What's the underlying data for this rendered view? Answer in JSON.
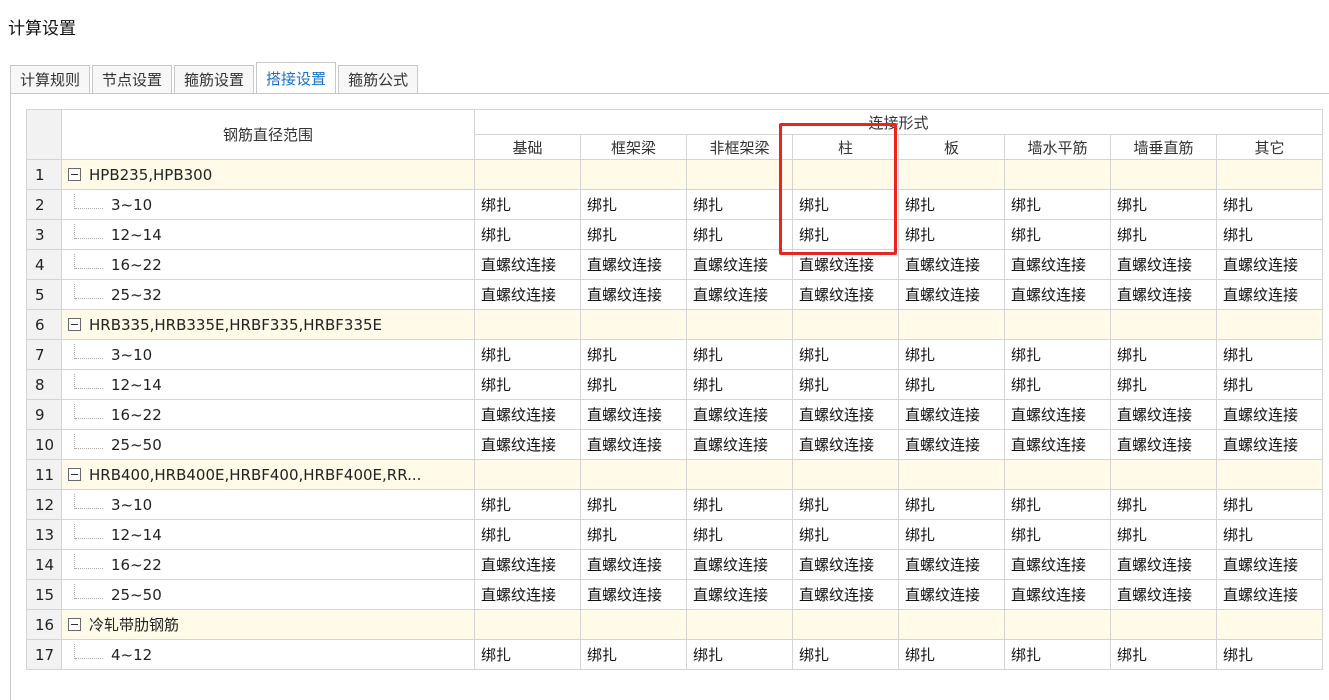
{
  "window": {
    "title": "计算设置"
  },
  "tabs": [
    {
      "label": "计算规则",
      "active": false
    },
    {
      "label": "节点设置",
      "active": false
    },
    {
      "label": "箍筋设置",
      "active": false
    },
    {
      "label": "搭接设置",
      "active": true
    },
    {
      "label": "箍筋公式",
      "active": false
    }
  ],
  "grid": {
    "range_header": "钢筋直径范围",
    "group_header": "连接形式",
    "columns": [
      "基础",
      "框架梁",
      "非框架梁",
      "柱",
      "板",
      "墙水平筋",
      "墙垂直筋",
      "其它"
    ],
    "rows": [
      {
        "num": "1",
        "type": "group",
        "name": "HPB235,HPB300"
      },
      {
        "num": "2",
        "type": "item",
        "name": "3~10",
        "values": [
          "绑扎",
          "绑扎",
          "绑扎",
          "绑扎",
          "绑扎",
          "绑扎",
          "绑扎",
          "绑扎"
        ]
      },
      {
        "num": "3",
        "type": "item",
        "name": "12~14",
        "values": [
          "绑扎",
          "绑扎",
          "绑扎",
          "绑扎",
          "绑扎",
          "绑扎",
          "绑扎",
          "绑扎"
        ]
      },
      {
        "num": "4",
        "type": "item",
        "name": "16~22",
        "values": [
          "直螺纹连接",
          "直螺纹连接",
          "直螺纹连接",
          "直螺纹连接",
          "直螺纹连接",
          "直螺纹连接",
          "直螺纹连接",
          "直螺纹连接"
        ]
      },
      {
        "num": "5",
        "type": "item",
        "name": "25~32",
        "values": [
          "直螺纹连接",
          "直螺纹连接",
          "直螺纹连接",
          "直螺纹连接",
          "直螺纹连接",
          "直螺纹连接",
          "直螺纹连接",
          "直螺纹连接"
        ]
      },
      {
        "num": "6",
        "type": "group",
        "name": "HRB335,HRB335E,HRBF335,HRBF335E"
      },
      {
        "num": "7",
        "type": "item",
        "name": "3~10",
        "values": [
          "绑扎",
          "绑扎",
          "绑扎",
          "绑扎",
          "绑扎",
          "绑扎",
          "绑扎",
          "绑扎"
        ]
      },
      {
        "num": "8",
        "type": "item",
        "name": "12~14",
        "values": [
          "绑扎",
          "绑扎",
          "绑扎",
          "绑扎",
          "绑扎",
          "绑扎",
          "绑扎",
          "绑扎"
        ]
      },
      {
        "num": "9",
        "type": "item",
        "name": "16~22",
        "values": [
          "直螺纹连接",
          "直螺纹连接",
          "直螺纹连接",
          "直螺纹连接",
          "直螺纹连接",
          "直螺纹连接",
          "直螺纹连接",
          "直螺纹连接"
        ]
      },
      {
        "num": "10",
        "type": "item",
        "name": "25~50",
        "values": [
          "直螺纹连接",
          "直螺纹连接",
          "直螺纹连接",
          "直螺纹连接",
          "直螺纹连接",
          "直螺纹连接",
          "直螺纹连接",
          "直螺纹连接"
        ]
      },
      {
        "num": "11",
        "type": "group",
        "name": "HRB400,HRB400E,HRBF400,HRBF400E,RR..."
      },
      {
        "num": "12",
        "type": "item",
        "name": "3~10",
        "values": [
          "绑扎",
          "绑扎",
          "绑扎",
          "绑扎",
          "绑扎",
          "绑扎",
          "绑扎",
          "绑扎"
        ]
      },
      {
        "num": "13",
        "type": "item",
        "name": "12~14",
        "values": [
          "绑扎",
          "绑扎",
          "绑扎",
          "绑扎",
          "绑扎",
          "绑扎",
          "绑扎",
          "绑扎"
        ]
      },
      {
        "num": "14",
        "type": "item",
        "name": "16~22",
        "values": [
          "直螺纹连接",
          "直螺纹连接",
          "直螺纹连接",
          "直螺纹连接",
          "直螺纹连接",
          "直螺纹连接",
          "直螺纹连接",
          "直螺纹连接"
        ]
      },
      {
        "num": "15",
        "type": "item",
        "name": "25~50",
        "values": [
          "直螺纹连接",
          "直螺纹连接",
          "直螺纹连接",
          "直螺纹连接",
          "直螺纹连接",
          "直螺纹连接",
          "直螺纹连接",
          "直螺纹连接"
        ]
      },
      {
        "num": "16",
        "type": "group",
        "name": "冷轧带肋钢筋"
      },
      {
        "num": "17",
        "type": "item",
        "name": "4~12",
        "values": [
          "绑扎",
          "绑扎",
          "绑扎",
          "绑扎",
          "绑扎",
          "绑扎",
          "绑扎",
          "绑扎"
        ]
      }
    ]
  },
  "highlight": {
    "column": "柱",
    "color": "#e8261c"
  }
}
